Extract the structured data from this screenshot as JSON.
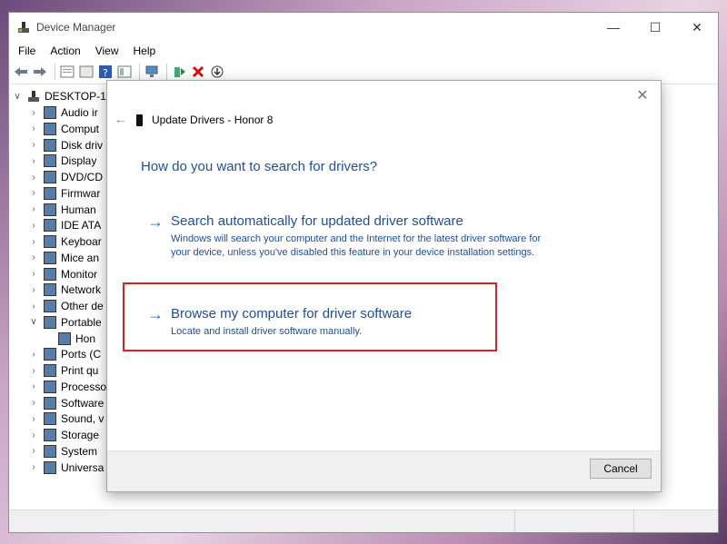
{
  "window": {
    "title": "Device Manager"
  },
  "menu": [
    "File",
    "Action",
    "View",
    "Help"
  ],
  "tree": {
    "root": "DESKTOP-1",
    "items": [
      {
        "label": "Audio ir",
        "icon": "speaker-icon",
        "expanded": false
      },
      {
        "label": "Comput",
        "icon": "monitor-icon",
        "expanded": false
      },
      {
        "label": "Disk driv",
        "icon": "disk-icon",
        "expanded": false
      },
      {
        "label": "Display",
        "icon": "display-icon",
        "expanded": false
      },
      {
        "label": "DVD/CD",
        "icon": "dvd-icon",
        "expanded": false
      },
      {
        "label": "Firmwar",
        "icon": "firmware-icon",
        "expanded": false
      },
      {
        "label": "Human",
        "icon": "hid-icon",
        "expanded": false
      },
      {
        "label": "IDE ATA",
        "icon": "ide-icon",
        "expanded": false
      },
      {
        "label": "Keyboar",
        "icon": "keyboard-icon",
        "expanded": false
      },
      {
        "label": "Mice an",
        "icon": "mouse-icon",
        "expanded": false
      },
      {
        "label": "Monitor",
        "icon": "monitor-icon",
        "expanded": false
      },
      {
        "label": "Network",
        "icon": "network-icon",
        "expanded": false
      },
      {
        "label": "Other de",
        "icon": "unknown-device-icon",
        "expanded": false
      },
      {
        "label": "Portable",
        "icon": "portable-device-icon",
        "expanded": true
      },
      {
        "label": "Hon",
        "icon": "phone-icon",
        "child": true
      },
      {
        "label": "Ports (C",
        "icon": "port-icon",
        "expanded": false
      },
      {
        "label": "Print qu",
        "icon": "printer-icon",
        "expanded": false
      },
      {
        "label": "Processo",
        "icon": "processor-icon",
        "expanded": false
      },
      {
        "label": "Software",
        "icon": "software-icon",
        "expanded": false
      },
      {
        "label": "Sound, v",
        "icon": "sound-icon",
        "expanded": false
      },
      {
        "label": "Storage",
        "icon": "storage-icon",
        "expanded": false
      },
      {
        "label": "System",
        "icon": "system-icon",
        "expanded": false
      },
      {
        "label": "Universa",
        "icon": "usb-icon",
        "expanded": false
      }
    ]
  },
  "dialog": {
    "header": "Update Drivers - Honor 8",
    "question": "How do you want to search for drivers?",
    "option1": {
      "title": "Search automatically for updated driver software",
      "desc": "Windows will search your computer and the Internet for the latest driver software for your device, unless you've disabled this feature in your device installation settings."
    },
    "option2": {
      "title": "Browse my computer for driver software",
      "desc": "Locate and install driver software manually."
    },
    "cancel": "Cancel"
  },
  "colors": {
    "link": "#1f4e9c",
    "highlight": "#e02020"
  }
}
